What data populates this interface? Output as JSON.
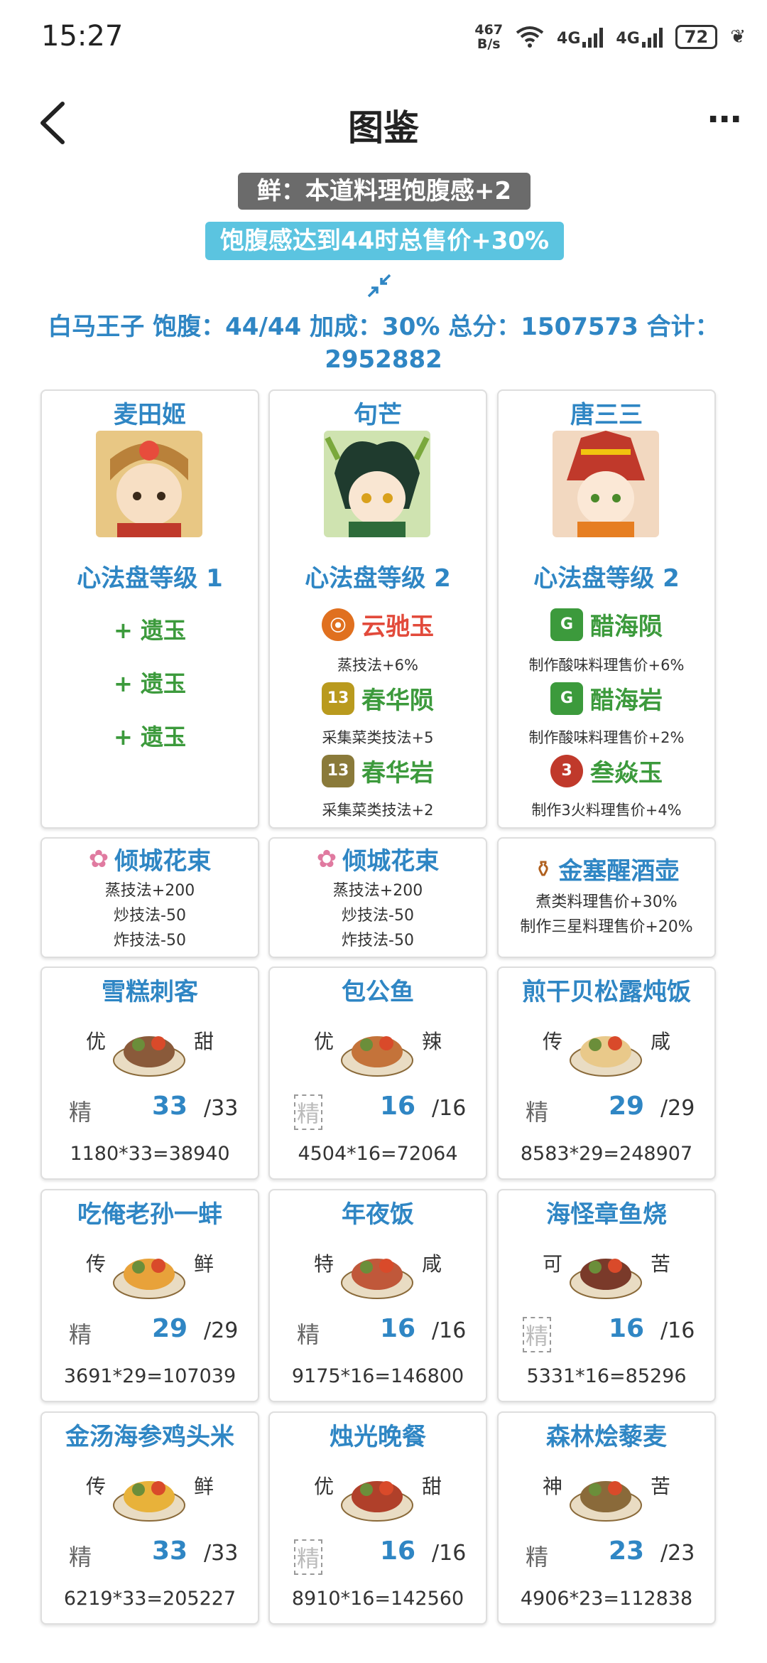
{
  "status": {
    "time": "15:27",
    "net_speed_top": "467",
    "net_speed_bottom": "B/s",
    "net1": "4G",
    "net2": "4G",
    "battery": "72"
  },
  "header": {
    "title": "图鉴"
  },
  "buff_tag": "鲜：本道料理饱腹感+2",
  "condition_tag": "饱腹感达到44时总售价+30%",
  "summary": {
    "line1": "白马王子 饱腹：44/44 加成：30% 总分：1507573 合计：",
    "line2": "2952882"
  },
  "chefs": [
    {
      "name": "麦田姬",
      "level": "心法盘等级 1",
      "jades": [
        {
          "plus": "+ 遗玉"
        },
        {
          "plus": "+ 遗玉"
        },
        {
          "plus": "+ 遗玉"
        }
      ]
    },
    {
      "name": "句芒",
      "level": "心法盘等级 2",
      "jades": [
        {
          "name": "云驰玉",
          "desc": "蒸技法+6%",
          "color": "#e24a3b",
          "icon": "红"
        },
        {
          "name": "春华陨",
          "desc": "采集菜类技法+5",
          "color": "#3c9a3c",
          "icon": "13"
        },
        {
          "name": "春华岩",
          "desc": "采集菜类技法+2",
          "color": "#3c9a3c",
          "icon": "13"
        }
      ]
    },
    {
      "name": "唐三三",
      "level": "心法盘等级 2",
      "jades": [
        {
          "name": "醋海陨",
          "desc": "制作酸味料理售价+6%",
          "color": "#3c9a3c",
          "icon": "G"
        },
        {
          "name": "醋海岩",
          "desc": "制作酸味料理售价+2%",
          "color": "#3c9a3c",
          "icon": "G"
        },
        {
          "name": "叁焱玉",
          "desc": "制作3火料理售价+4%",
          "color": "#3c9a3c",
          "icon": "3"
        }
      ]
    }
  ],
  "equips": [
    {
      "name": "倾城花束",
      "lines": [
        "蒸技法+200",
        "炒技法-50",
        "炸技法-50"
      ]
    },
    {
      "name": "倾城花束",
      "lines": [
        "蒸技法+200",
        "炒技法-50",
        "炸技法-50"
      ]
    },
    {
      "name": "金塞醒酒壶",
      "lines": [
        "煮类料理售价+30%",
        "制作三星料理售价+20%"
      ]
    }
  ],
  "recipes": [
    {
      "name": "雪糕刺客",
      "rarity": "优",
      "taste": "甜",
      "skill": "精",
      "qty": "33",
      "max": "/33",
      "calc": "1180*33=38940"
    },
    {
      "name": "包公鱼",
      "rarity": "优",
      "taste": "辣",
      "skill": "精",
      "qty": "16",
      "max": "/16",
      "calc": "4504*16=72064"
    },
    {
      "name": "煎干贝松露炖饭",
      "rarity": "传",
      "taste": "咸",
      "skill": "精",
      "qty": "29",
      "max": "/29",
      "calc": "8583*29=248907"
    },
    {
      "name": "吃俺老孙一蚌",
      "rarity": "传",
      "taste": "鲜",
      "skill": "精",
      "qty": "29",
      "max": "/29",
      "calc": "3691*29=107039"
    },
    {
      "name": "年夜饭",
      "rarity": "特",
      "taste": "咸",
      "skill": "精",
      "qty": "16",
      "max": "/16",
      "calc": "9175*16=146800"
    },
    {
      "name": "海怪章鱼烧",
      "rarity": "可",
      "taste": "苦",
      "skill": "精",
      "qty": "16",
      "max": "/16",
      "calc": "5331*16=85296"
    },
    {
      "name": "金汤海参鸡头米",
      "rarity": "传",
      "taste": "鲜",
      "skill": "精",
      "qty": "33",
      "max": "/33",
      "calc": "6219*33=205227"
    },
    {
      "name": "烛光晚餐",
      "rarity": "优",
      "taste": "甜",
      "skill": "精",
      "qty": "16",
      "max": "/16",
      "calc": "8910*16=142560"
    },
    {
      "name": "森林烩藜麦",
      "rarity": "神",
      "taste": "苦",
      "skill": "精",
      "qty": "23",
      "max": "/23",
      "calc": "4906*23=112838"
    }
  ],
  "colors": {
    "accent": "#2f86c4",
    "green": "#3c9a3c",
    "red": "#e24a3b",
    "tag_blue": "#5bc4e0",
    "tag_dark": "#6b6b6b"
  }
}
